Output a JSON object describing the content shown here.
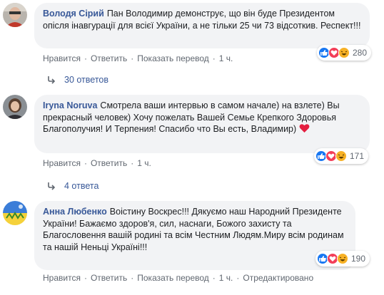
{
  "comments": [
    {
      "author": "Володя Сірий",
      "text": "Пан Володимир демонструє, що він буде Президентом опісля інавгурації для всієї України, а не тільки 25 чи 73 відсоткив. Респект!!!",
      "reaction_count": "280",
      "actions": {
        "like": "Нравится",
        "reply": "Ответить",
        "translate": "Показать перевод",
        "time": "1 ч."
      },
      "replies": "30 ответов"
    },
    {
      "author": "Iryna Noruva",
      "text": "Смотрела ваши интервью в самом начале) на взлете) Вы прекрасный человек) Хочу пожелать Вашей Семье Крепкого Здоровья Благополучия! И Терпения! Спасибо что Вы есть, Владимир)",
      "reaction_count": "171",
      "actions": {
        "like": "Нравится",
        "reply": "Ответить",
        "time": "1 ч."
      },
      "replies": "4 ответа"
    },
    {
      "author": "Анна Любенко",
      "text": "Воістину Воскрес!!! Дякуємо наш Народний Президенте України! Бажаємо здоров'я, сил, наснаги, Божого захисту та Благословення вашій родині та всім Честним Людям.Миру всім родинам та нашій Неньці Україні!!!",
      "reaction_count": "190",
      "actions": {
        "like": "Нравится",
        "reply": "Ответить",
        "translate": "Показать перевод",
        "time": "1 ч.",
        "edited": "Отредактировано"
      }
    }
  ],
  "colors": {
    "link": "#385898",
    "muted": "#606770",
    "bubble": "#f2f3f5",
    "heart": "#e41e3f",
    "like": "#1877f2"
  },
  "icons": [
    "like-icon",
    "love-icon",
    "haha-icon",
    "reply-arrow-icon",
    "heart-emoji-icon"
  ]
}
